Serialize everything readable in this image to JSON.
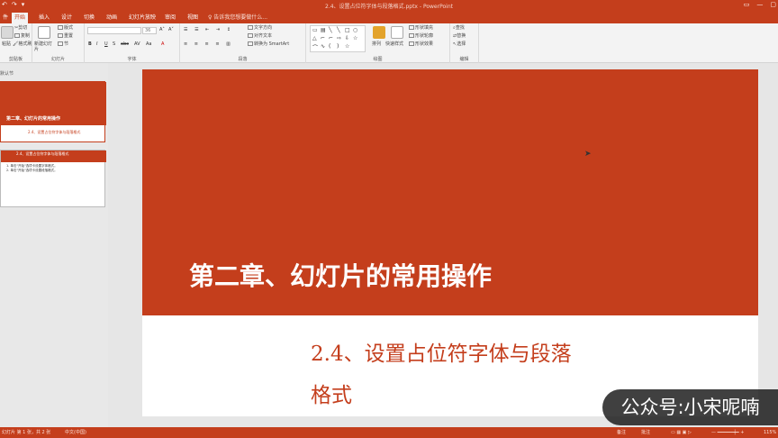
{
  "titlebar": {
    "quick_access": [
      "↶",
      "↷",
      "▾"
    ],
    "document_title": "2.4、设置占位符字体与段落格式.pptx - PowerPoint",
    "window_controls": [
      "▭",
      "—",
      "▢"
    ]
  },
  "tabs": {
    "items": [
      "件",
      "开始",
      "插入",
      "设计",
      "切换",
      "动画",
      "幻灯片放映",
      "审阅",
      "视图",
      "帮助"
    ],
    "active_index": 1,
    "tell_me": "♀ 告诉我您想要做什么..."
  },
  "ribbon": {
    "clipboard": {
      "paste": "粘贴",
      "cut": "剪切",
      "copy": "复制",
      "format_painter": "格式刷",
      "label": "剪贴板"
    },
    "slides": {
      "new_slide": "新建幻灯片",
      "layout": "版式",
      "reset": "重置",
      "section": "节",
      "label": "幻灯片"
    },
    "font": {
      "name": "",
      "size": "36",
      "label": "字体",
      "format_buttons": [
        "B",
        "I",
        "U",
        "S",
        "abc",
        "AV",
        "Aa",
        "A"
      ]
    },
    "paragraph": {
      "text_direction": "文字方向",
      "align_text": "对齐文本",
      "smartart": "转换为 SmartArt",
      "label": "段落"
    },
    "drawing": {
      "arrange": "排列",
      "quick_styles": "快速样式",
      "shape_fill": "形状填充",
      "shape_outline": "形状轮廓",
      "shape_effects": "形状效果",
      "label": "绘图"
    },
    "editing": {
      "find": "查找",
      "replace": "替换",
      "select": "选择",
      "label": "编辑"
    }
  },
  "left_pane": {
    "section_label": "默认节",
    "thumb1": {
      "title": "第二章、幻灯片的常用操作",
      "subtitle": "2.4、设置占位符字体与段落格式"
    },
    "thumb2": {
      "title": "2.4、设置占位符字体与段落格式",
      "body": "1. 单击\"开始\"选项卡设置字体格式。\n2. 单击\"开始\"选项卡设置段落格式。"
    }
  },
  "slide": {
    "title": "第二章、幻灯片的常用操作",
    "subtitle": "2.4、设置占位符字体与段落格式"
  },
  "watermark": "公众号:小宋呢喃",
  "statusbar": {
    "slide_info": "幻灯片 第 1 张，共 2 张",
    "language": "中文(中国)",
    "notes": "备注",
    "comments": "批注",
    "zoom": "115%"
  },
  "colors": {
    "accent": "#c43e1c",
    "slide_text": "#ffffff"
  }
}
